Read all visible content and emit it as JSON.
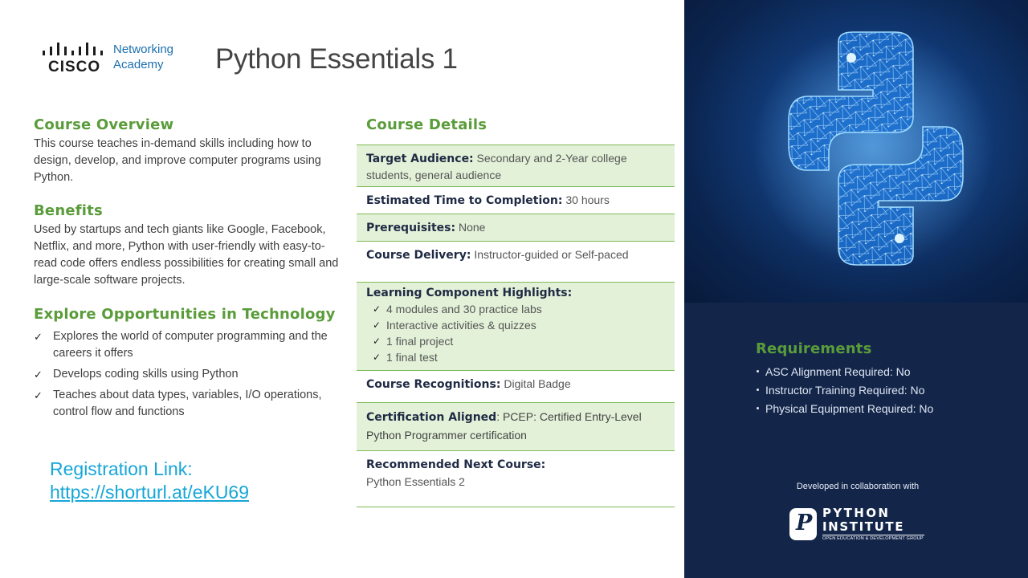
{
  "header": {
    "logo_brand": "CISCO",
    "logo_line1": "Networking",
    "logo_line2": "Academy",
    "title": "Python Essentials 1"
  },
  "overview": {
    "heading": "Course Overview",
    "text": "This course teaches in-demand skills including how to design, develop, and improve computer programs using Python."
  },
  "benefits": {
    "heading": "Benefits",
    "text": "Used by startups and tech giants like Google, Facebook, Netflix, and more, Python with user-friendly with easy-to-read code offers endless possibilities for creating small and large-scale software projects."
  },
  "explore": {
    "heading": "Explore Opportunities in Technology",
    "items": [
      "Explores the world of computer programming and the careers it offers",
      "Develops coding skills using Python",
      "Teaches about data types, variables, I/O operations, control flow and functions"
    ]
  },
  "registration": {
    "label": "Registration Link:",
    "url": "https://shorturl.at/eKU69"
  },
  "details": {
    "heading": "Course Details",
    "target_label": "Target Audience:",
    "target_value": "Secondary and 2-Year college students, general audience",
    "time_label": "Estimated Time to Completion:",
    "time_value": "30 hours",
    "prereq_label": "Prerequisites:",
    "prereq_value": "None",
    "delivery_label": "Course Delivery:",
    "delivery_value": "Instructor-guided or Self-paced",
    "highlights_label": "Learning Component Highlights:",
    "highlights": [
      "4 modules and 30 practice labs",
      "Interactive activities & quizzes",
      "1 final project",
      "1 final test"
    ],
    "recog_label": "Course Recognitions:",
    "recog_value": "Digital Badge",
    "cert_label": "Certification Aligned",
    "cert_value": ": PCEP: Certified Entry-Level Python Programmer certification",
    "next_label": "Recommended Next Course:",
    "next_value": "Python Essentials 2"
  },
  "requirements": {
    "heading": "Requirements",
    "items": [
      "ASC Alignment Required: No",
      "Instructor Training Required: No",
      "Physical Equipment Required: No"
    ]
  },
  "collab": {
    "text": "Developed in collaboration with",
    "logo_word1": "PYTHON",
    "logo_word2": "INSTITUTE",
    "logo_tagline": "OPEN EDUCATION & DEVELOPMENT GROUP"
  },
  "colors": {
    "green_heading": "#5a9c3a",
    "navy_panel": "#13264a",
    "link_blue": "#16a6d8",
    "row_shade": "#e3f1d8"
  }
}
